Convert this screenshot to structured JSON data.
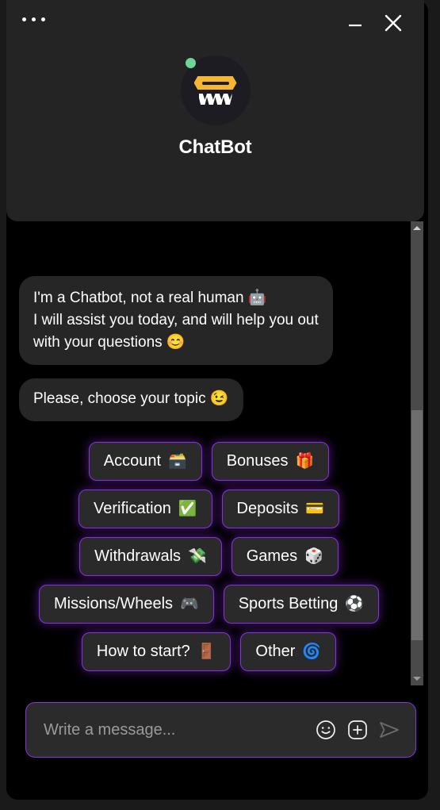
{
  "window": {
    "menu_icon": "three-dots-icon",
    "minimize_label": "—",
    "close_label": "✕",
    "background_color": "#1a1a1a",
    "chat_background_color": "#000000",
    "header_background_color": "#242424"
  },
  "header": {
    "bot_name": "ChatBot",
    "avatar_icon": "chatbot-avatar-icon",
    "status": "online",
    "status_color": "#6dd49a",
    "visor_color": "#f5b731"
  },
  "messages": [
    {
      "id": "intro",
      "text": "I'm a Chatbot, not a real human 🤖\nI will assist you today, and will help you out with your questions 😊",
      "lines": [
        "I'm a Chatbot, not a real human 🤖",
        "I will assist you today, and will help you out with your questions 😊"
      ],
      "sender": "bot",
      "clipped_top": true
    },
    {
      "id": "topic-prompt",
      "text": "Please, choose your topic 😉",
      "sender": "bot",
      "clipped_top": false
    }
  ],
  "topic_buttons": {
    "accent_color": "#8b2fe3",
    "rows": [
      [
        {
          "label": "Account",
          "emoji": "🗃️",
          "icon": "card-file-box-icon"
        },
        {
          "label": "Bonuses",
          "emoji": "🎁",
          "icon": "gift-icon"
        }
      ],
      [
        {
          "label": "Verification",
          "emoji": "✅",
          "icon": "check-mark-icon"
        },
        {
          "label": "Deposits",
          "emoji": "💳",
          "icon": "credit-card-icon"
        }
      ],
      [
        {
          "label": "Withdrawals",
          "emoji": "💸",
          "icon": "money-with-wings-icon"
        },
        {
          "label": "Games",
          "emoji": "🎲",
          "icon": "dice-icon"
        }
      ],
      [
        {
          "label": "Missions/Wheels",
          "emoji": "🎮",
          "icon": "game-controller-icon"
        },
        {
          "label": "Sports Betting",
          "emoji": "⚽",
          "icon": "soccer-ball-icon"
        }
      ],
      [
        {
          "label": "How to start?",
          "emoji": "🚪",
          "icon": "door-icon"
        },
        {
          "label": "Other",
          "emoji": "🌀",
          "icon": "cyclone-icon"
        }
      ]
    ]
  },
  "composer": {
    "placeholder": "Write a message...",
    "value": "",
    "emoji_icon": "smiley-face-icon",
    "attach_icon": "plus-circle-icon",
    "send_icon": "send-arrow-icon",
    "border_color": "#8b2fe3"
  },
  "scrollbar": {
    "up_icon": "chevron-up-icon",
    "down_icon": "chevron-down-icon",
    "thumb_position": "lower"
  }
}
